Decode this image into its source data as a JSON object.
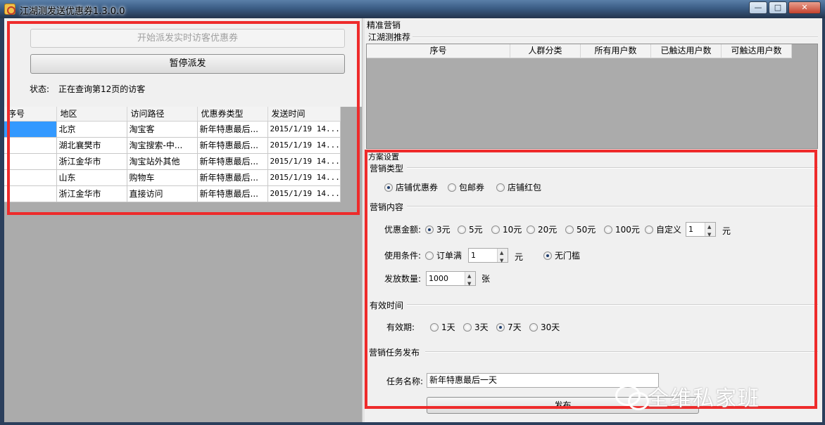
{
  "window": {
    "title": "江湖测发送优惠券1.3.0.0",
    "min": "—",
    "max": "□",
    "close": "✕"
  },
  "left": {
    "start_button": "开始派发实时访客优惠券",
    "pause_button": "暂停派发",
    "status_label": "状态:",
    "status_value": "正在查询第12页的访客",
    "table": {
      "headers": [
        "序号",
        "地区",
        "访问路径",
        "优惠券类型",
        "发送时间"
      ],
      "rows": [
        [
          "",
          "北京",
          "淘宝客",
          "新年特惠最后...",
          "2015/1/19 14..."
        ],
        [
          "",
          "湖北襄樊市",
          "淘宝搜索-中...",
          "新年特惠最后...",
          "2015/1/19 14..."
        ],
        [
          "",
          "浙江金华市",
          "淘宝站外其他",
          "新年特惠最后...",
          "2015/1/19 14..."
        ],
        [
          "",
          "山东",
          "购物车",
          "新年特惠最后...",
          "2015/1/19 14..."
        ],
        [
          "",
          "浙江金华市",
          "直接访问",
          "新年特惠最后...",
          "2015/1/19 14..."
        ]
      ]
    }
  },
  "right": {
    "precision_title": "精准营销",
    "recommend_title": "江湖测推荐",
    "recommend_headers": [
      "序号",
      "人群分类",
      "所有用户数",
      "已触达用户数",
      "可触达用户数"
    ],
    "scheme_title": "方案设置",
    "marketing_type": {
      "title": "营销类型",
      "options": [
        "店铺优惠券",
        "包邮券",
        "店铺红包"
      ],
      "selected": "店铺优惠券"
    },
    "marketing_content": {
      "title": "营销内容",
      "amount_label": "优惠金额:",
      "amount_options": [
        "3元",
        "5元",
        "10元",
        "20元",
        "50元",
        "100元",
        "自定义"
      ],
      "amount_selected": "3元",
      "custom_value": "1",
      "custom_unit": "元",
      "condition_label": "使用条件:",
      "condition_option": "订单满",
      "condition_value": "1",
      "condition_unit": "元",
      "no_threshold": "无门槛",
      "quantity_label": "发放数量:",
      "quantity_value": "1000",
      "quantity_unit": "张"
    },
    "validity": {
      "title": "有效时间",
      "label": "有效期:",
      "options": [
        "1天",
        "3天",
        "7天",
        "30天"
      ],
      "selected": "7天"
    },
    "publish": {
      "title": "营销任务发布",
      "task_label": "任务名称:",
      "task_value": "新年特惠最后一天",
      "publish_button": "发布"
    }
  },
  "watermark": {
    "text": "全维私家班"
  }
}
